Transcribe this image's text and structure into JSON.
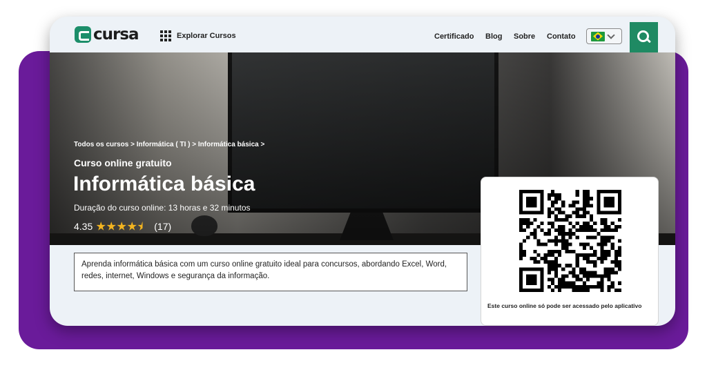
{
  "header": {
    "logo_text": "cursa",
    "explore_label": "Explorar Cursos",
    "nav": [
      "Certificado",
      "Blog",
      "Sobre",
      "Contato"
    ],
    "language": "pt-BR"
  },
  "hero": {
    "breadcrumb": [
      "Todos os cursos",
      "Informática ( TI )",
      "Informática básica"
    ],
    "kicker": "Curso online gratuito",
    "title": "Informática básica",
    "duration": "Duração do curso online: 13 horas e 32 minutos",
    "rating": "4.35",
    "rating_count": "(17)"
  },
  "description": "Aprenda informática básica com um curso online gratuito ideal para concursos, abordando Excel, Word, redes, internet, Windows e segurança da informação.",
  "qr_card": {
    "note": "Este curso online só pode ser acessado pelo aplicativo"
  },
  "colors": {
    "brand_green": "#1f8a63",
    "frame_purple": "#6a1b9a",
    "star": "#f2b420"
  }
}
